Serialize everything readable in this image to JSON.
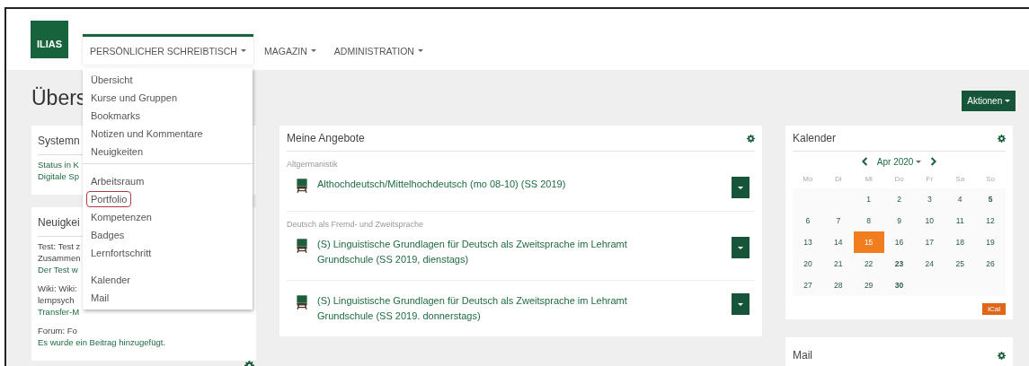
{
  "brand": {
    "logo": "ILIAS"
  },
  "nav": [
    {
      "label": "PERSÖNLICHER SCHREIBTISCH",
      "selected": true
    },
    {
      "label": "MAGAZIN",
      "selected": false
    },
    {
      "label": "ADMINISTRATION",
      "selected": false
    }
  ],
  "dropdown": {
    "groups": [
      [
        {
          "label": "Übersicht",
          "highlighted": false
        },
        {
          "label": "Kurse und Gruppen",
          "highlighted": false
        },
        {
          "label": "Bookmarks",
          "highlighted": false
        },
        {
          "label": "Notizen und Kommentare",
          "highlighted": false
        },
        {
          "label": "Neuigkeiten",
          "highlighted": false
        }
      ],
      [
        {
          "label": "Arbeitsraum",
          "highlighted": false
        },
        {
          "label": "Portfolio",
          "highlighted": true
        },
        {
          "label": "Kompetenzen",
          "highlighted": false
        },
        {
          "label": "Badges",
          "highlighted": false
        },
        {
          "label": "Lernfortschritt",
          "highlighted": false
        }
      ],
      [
        {
          "label": "Kalender",
          "highlighted": false
        },
        {
          "label": "Mail",
          "highlighted": false
        }
      ]
    ]
  },
  "page_title": "Übers",
  "actions_button": "Aktionen",
  "left_panels": [
    {
      "title": "Systemn",
      "groups": [
        [
          {
            "text": "Status in K",
            "kind": "link"
          },
          {
            "text": "Digitale Sp",
            "kind": "link"
          }
        ]
      ]
    },
    {
      "title": "Neuigkei",
      "groups": [
        [
          {
            "text": "Test: Test z",
            "kind": "text"
          },
          {
            "text": "Zusammen",
            "kind": "text"
          },
          {
            "text": "Der Test w",
            "kind": "link"
          }
        ],
        [
          {
            "text": "Wiki: Wiki:",
            "kind": "text"
          },
          {
            "text": "lernpsych",
            "kind": "text"
          },
          {
            "text": "Transfer-M",
            "kind": "link"
          }
        ],
        [
          {
            "text": "Forum: Fo",
            "kind": "text"
          },
          {
            "text": "Es wurde ein Beitrag hinzugefügt.",
            "kind": "link"
          }
        ]
      ]
    }
  ],
  "offers": {
    "title": "Meine Angebote",
    "categories": [
      {
        "name": "Altgermanistik",
        "courses": [
          {
            "title": "Althochdeutsch/Mittelhochdeutsch (mo 08-10) (SS 2019)"
          }
        ]
      },
      {
        "name": "Deutsch als Fremd- und Zweitsprache",
        "courses": [
          {
            "title": "(S) Linguistische Grundlagen für Deutsch als Zweitsprache im Lehramt Grundschule (SS 2019, dienstags)"
          },
          {
            "title": "(S) Linguistische Grundlagen für Deutsch als Zweitsprache im Lehramt Grundschule (SS 2019. donnerstags)"
          }
        ]
      }
    ]
  },
  "calendar": {
    "title": "Kalender",
    "month": "Apr 2020",
    "weekdays": [
      "Mo",
      "Di",
      "Mi",
      "Do",
      "Fr",
      "Sa",
      "So"
    ],
    "weeks": [
      [
        {
          "day": "1",
          "bold": false,
          "today": false
        },
        {
          "day": "2",
          "bold": false,
          "today": false
        },
        {
          "day": "3",
          "bold": false,
          "today": false
        },
        {
          "day": "4",
          "bold": false,
          "today": false
        },
        {
          "day": "5",
          "bold": true,
          "today": false
        }
      ],
      [
        {
          "day": "6",
          "bold": false,
          "today": false
        },
        {
          "day": "7",
          "bold": false,
          "today": false
        },
        {
          "day": "8",
          "bold": false,
          "today": false
        },
        {
          "day": "9",
          "bold": false,
          "today": false
        },
        {
          "day": "10",
          "bold": false,
          "today": false
        },
        {
          "day": "11",
          "bold": false,
          "today": false
        },
        {
          "day": "12",
          "bold": false,
          "today": false
        }
      ],
      [
        {
          "day": "13",
          "bold": false,
          "today": false
        },
        {
          "day": "14",
          "bold": false,
          "today": false
        },
        {
          "day": "15",
          "bold": false,
          "today": true
        },
        {
          "day": "16",
          "bold": false,
          "today": false
        },
        {
          "day": "17",
          "bold": false,
          "today": false
        },
        {
          "day": "18",
          "bold": false,
          "today": false
        },
        {
          "day": "19",
          "bold": false,
          "today": false
        }
      ],
      [
        {
          "day": "20",
          "bold": false,
          "today": false
        },
        {
          "day": "21",
          "bold": false,
          "today": false
        },
        {
          "day": "22",
          "bold": false,
          "today": false
        },
        {
          "day": "23",
          "bold": true,
          "today": false
        },
        {
          "day": "24",
          "bold": false,
          "today": false
        },
        {
          "day": "25",
          "bold": false,
          "today": false
        },
        {
          "day": "26",
          "bold": false,
          "today": false
        }
      ],
      [
        {
          "day": "27",
          "bold": false,
          "today": false
        },
        {
          "day": "28",
          "bold": false,
          "today": false
        },
        {
          "day": "29",
          "bold": false,
          "today": false
        },
        {
          "day": "30",
          "bold": true,
          "today": false
        }
      ]
    ],
    "ical": "iCal"
  },
  "mail": {
    "title": "Mail"
  }
}
